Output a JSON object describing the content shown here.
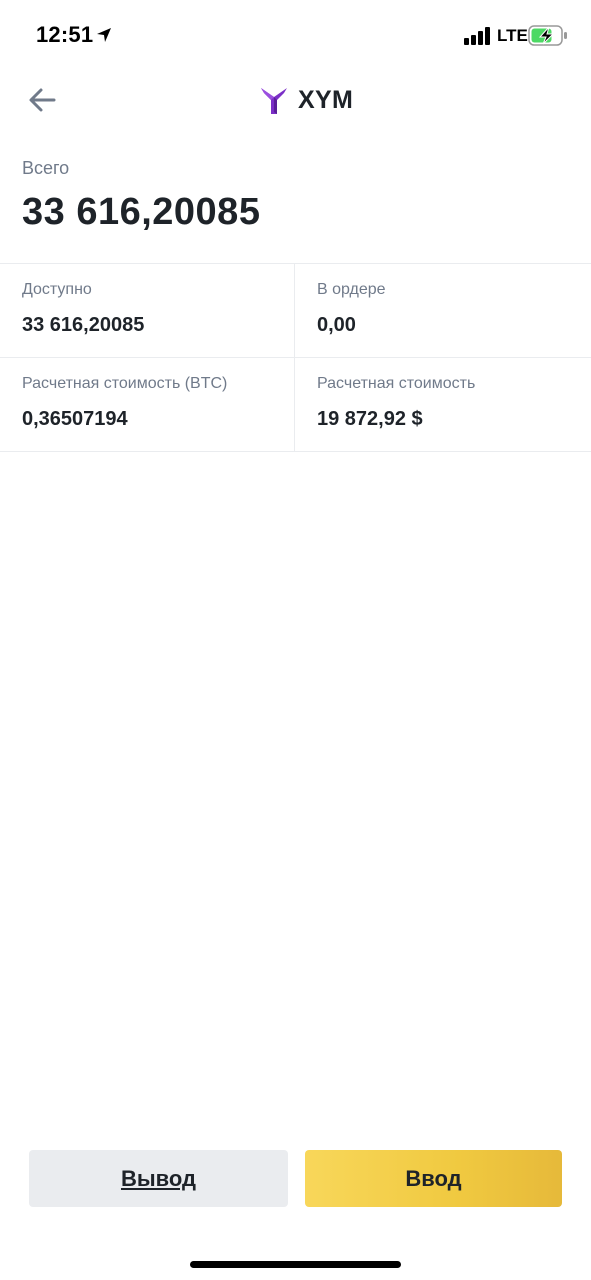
{
  "status_bar": {
    "time": "12:51",
    "network": "LTE",
    "icons": [
      "location-arrow-icon",
      "signal-bars-icon",
      "battery-charging-icon"
    ]
  },
  "header": {
    "title": "XYM",
    "back_icon": "back-arrow-icon",
    "logo_icon": "symbol-xym-logo-icon",
    "logo_color": "#7b2fc7"
  },
  "total": {
    "label": "Всего",
    "value": "33 616,20085"
  },
  "details": {
    "available_label": "Доступно",
    "available_value": "33 616,20085",
    "in_order_label": "В ордере",
    "in_order_value": "0,00",
    "est_btc_label": "Расчетная стоимость (BTC)",
    "est_btc_value": "0,36507194",
    "est_value_label": "Расчетная стоимость",
    "est_value_value": "19 872,92 $"
  },
  "actions": {
    "withdraw_label": "Вывод",
    "deposit_label": "Ввод"
  },
  "colors": {
    "accent": "#f0c940",
    "text_primary": "#1e2329",
    "text_secondary": "#707a8a",
    "divider": "#eaecef"
  }
}
